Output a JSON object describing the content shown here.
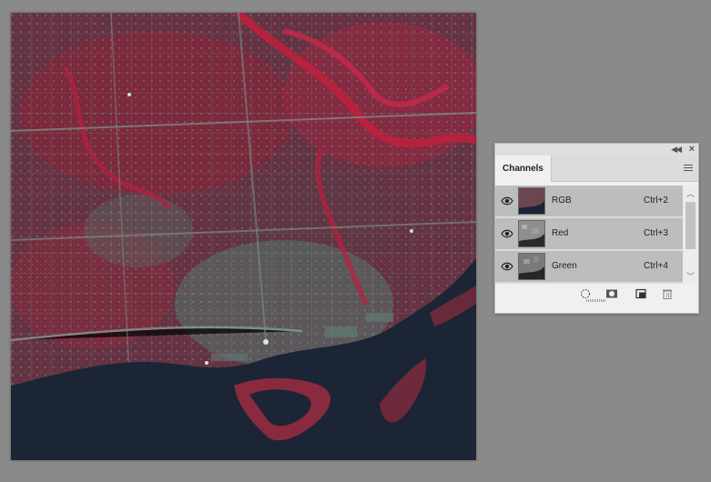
{
  "panel": {
    "tab_label": "Channels",
    "title_icons": [
      "collapse-icon",
      "close-icon"
    ],
    "menu_icon": "hamburger-menu-icon"
  },
  "channels": [
    {
      "name": "RGB",
      "shortcut": "Ctrl+2",
      "visible": true,
      "thumb": "color"
    },
    {
      "name": "Red",
      "shortcut": "Ctrl+3",
      "visible": true,
      "thumb": "gray"
    },
    {
      "name": "Green",
      "shortcut": "Ctrl+4",
      "visible": true,
      "thumb": "gray"
    }
  ],
  "bottom_buttons": [
    "load-selection-icon",
    "save-selection-icon",
    "new-channel-icon",
    "trash-icon"
  ],
  "colors": {
    "canvas_bg": "#8a8a8a",
    "land_dark": "#3d3a42",
    "vegetation": "#b02040",
    "water": "#1b2535",
    "urban_teal": "#5f7a74"
  }
}
